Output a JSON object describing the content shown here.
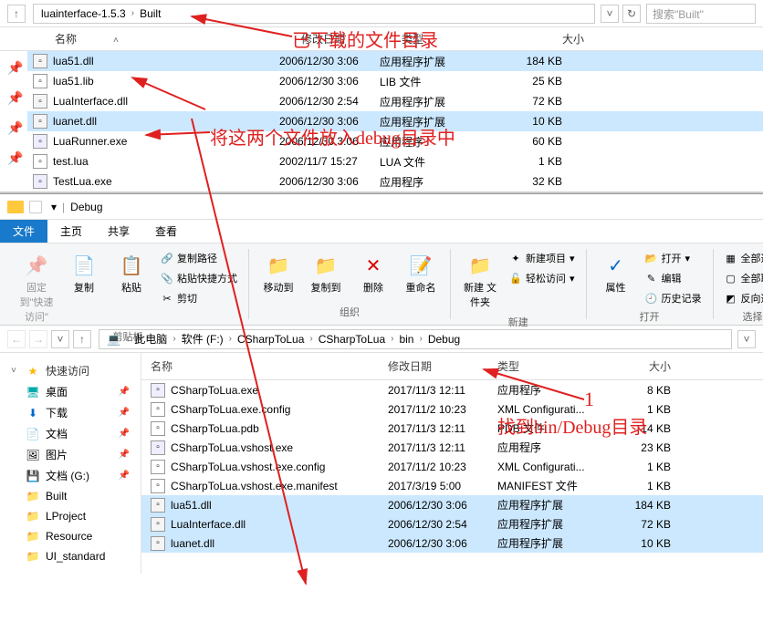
{
  "top": {
    "breadcrumb": [
      "luainterface-1.5.3",
      "Built"
    ],
    "search_placeholder": "搜索\"Built\"",
    "headers": {
      "name": "名称",
      "date": "修改日期",
      "type": "类型",
      "size": "大小"
    },
    "files": [
      {
        "name": "lua51.dll",
        "date": "2006/12/30 3:06",
        "type": "应用程序扩展",
        "size": "184 KB",
        "icon": "dll",
        "selected": true
      },
      {
        "name": "lua51.lib",
        "date": "2006/12/30 3:06",
        "type": "LIB 文件",
        "size": "25 KB",
        "icon": "lib",
        "selected": false
      },
      {
        "name": "LuaInterface.dll",
        "date": "2006/12/30 2:54",
        "type": "应用程序扩展",
        "size": "72 KB",
        "icon": "dll",
        "selected": false
      },
      {
        "name": "luanet.dll",
        "date": "2006/12/30 3:06",
        "type": "应用程序扩展",
        "size": "10 KB",
        "icon": "dll",
        "selected": true
      },
      {
        "name": "LuaRunner.exe",
        "date": "2006/12/30 3:06",
        "type": "应用程序",
        "size": "60 KB",
        "icon": "exe",
        "selected": false
      },
      {
        "name": "test.lua",
        "date": "2002/11/7 15:27",
        "type": "LUA 文件",
        "size": "1 KB",
        "icon": "lua",
        "selected": false
      },
      {
        "name": "TestLua.exe",
        "date": "2006/12/30 3:06",
        "type": "应用程序",
        "size": "32 KB",
        "icon": "exe",
        "selected": false
      }
    ]
  },
  "annotations": {
    "ann1": "已下载的文件目录",
    "ann2": "将这两个文件放入debug目录中",
    "ann3_num": "1",
    "ann3": "找到bin/Debug目录"
  },
  "bottom": {
    "title": "Debug",
    "menu": {
      "file": "文件",
      "home": "主页",
      "share": "共享",
      "view": "查看"
    },
    "ribbon": {
      "pin_label": "固定到\"快速访问\"",
      "copy": "复制",
      "paste": "粘贴",
      "copy_path": "复制路径",
      "paste_shortcut": "粘贴快捷方式",
      "cut": "剪切",
      "clipboard_group": "剪贴板",
      "move_to": "移动到",
      "copy_to": "复制到",
      "delete": "删除",
      "rename": "重命名",
      "organize_group": "组织",
      "new_folder": "新建\n文件夹",
      "new_item": "新建项目",
      "easy_access": "轻松访问",
      "new_group": "新建",
      "properties": "属性",
      "open": "打开",
      "edit": "编辑",
      "history": "历史记录",
      "open_group": "打开",
      "select_all": "全部选择",
      "select_none": "全部取消",
      "invert": "反向选择",
      "select_group": "选择"
    },
    "breadcrumb": [
      "此电脑",
      "软件 (F:)",
      "CSharpToLua",
      "CSharpToLua",
      "bin",
      "Debug"
    ],
    "sidebar": {
      "quick_access": "快速访问",
      "desktop": "桌面",
      "downloads": "下载",
      "documents": "文档",
      "pictures": "图片",
      "docs_g": "文档 (G:)",
      "built": "Built",
      "lproject": "LProject",
      "resource": "Resource",
      "ui_standard": "UI_standard"
    },
    "headers": {
      "name": "名称",
      "date": "修改日期",
      "type": "类型",
      "size": "大小"
    },
    "files": [
      {
        "name": "CSharpToLua.exe",
        "date": "2017/11/3 12:11",
        "type": "应用程序",
        "size": "8 KB",
        "icon": "exe",
        "selected": false
      },
      {
        "name": "CSharpToLua.exe.config",
        "date": "2017/11/2 10:23",
        "type": "XML Configurati...",
        "size": "1 KB",
        "icon": "cfg",
        "selected": false
      },
      {
        "name": "CSharpToLua.pdb",
        "date": "2017/11/3 12:11",
        "type": "PDB 文件",
        "size": "14 KB",
        "icon": "pdb",
        "selected": false
      },
      {
        "name": "CSharpToLua.vshost.exe",
        "date": "2017/11/3 12:11",
        "type": "应用程序",
        "size": "23 KB",
        "icon": "exe",
        "selected": false
      },
      {
        "name": "CSharpToLua.vshost.exe.config",
        "date": "2017/11/2 10:23",
        "type": "XML Configurati...",
        "size": "1 KB",
        "icon": "cfg",
        "selected": false
      },
      {
        "name": "CSharpToLua.vshost.exe.manifest",
        "date": "2017/3/19 5:00",
        "type": "MANIFEST 文件",
        "size": "1 KB",
        "icon": "cfg",
        "selected": false
      },
      {
        "name": "lua51.dll",
        "date": "2006/12/30 3:06",
        "type": "应用程序扩展",
        "size": "184 KB",
        "icon": "dll",
        "selected": true
      },
      {
        "name": "LuaInterface.dll",
        "date": "2006/12/30 2:54",
        "type": "应用程序扩展",
        "size": "72 KB",
        "icon": "dll",
        "selected": true
      },
      {
        "name": "luanet.dll",
        "date": "2006/12/30 3:06",
        "type": "应用程序扩展",
        "size": "10 KB",
        "icon": "dll",
        "selected": true
      }
    ]
  }
}
